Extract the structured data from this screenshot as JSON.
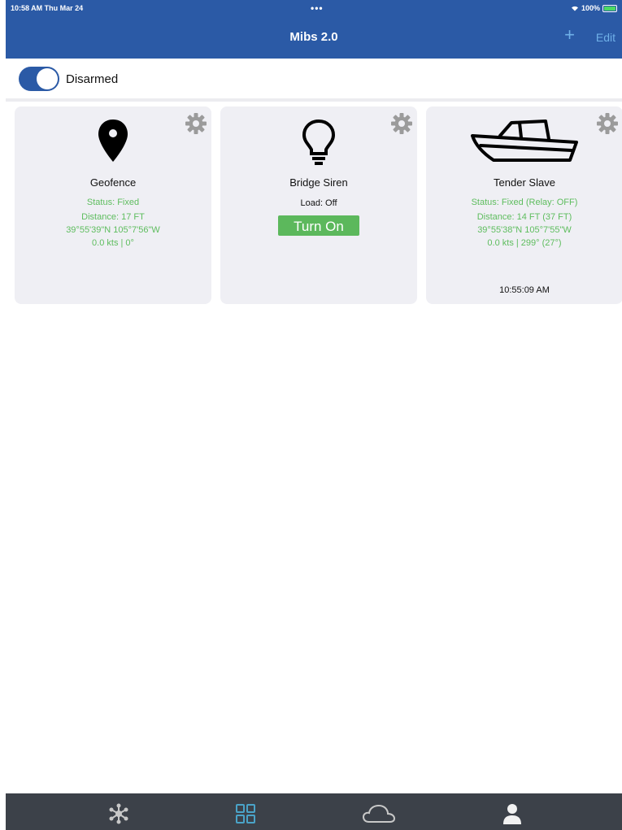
{
  "status_bar": {
    "time_date": "10:58 AM  Thu Mar 24",
    "dots": "•••",
    "battery": "100%"
  },
  "nav": {
    "title": "Mibs 2.0",
    "add_label": "+",
    "edit_label": "Edit"
  },
  "arm": {
    "label": "Disarmed",
    "toggle_on": true
  },
  "cards": [
    {
      "title": "Geofence",
      "icon": "map-pin-icon",
      "lines": [
        "Status: Fixed",
        "Distance: 17 FT",
        "39°55'39\"N 105°7'56\"W",
        "0.0 kts | 0°"
      ]
    },
    {
      "title": "Bridge Siren",
      "icon": "lightbulb-icon",
      "load": "Load: Off",
      "button_label": "Turn On"
    },
    {
      "title": "Tender Slave",
      "icon": "boat-icon",
      "lines": [
        "Status: Fixed (Relay: OFF)",
        "Distance: 14 FT (37 FT)",
        "39°55'38\"N 105°7'55\"W",
        "0.0 kts | 299° (27°)"
      ],
      "time": "10:55:09 AM"
    }
  ],
  "tabbar": {
    "tabs": [
      "network-icon",
      "grid-icon",
      "cloud-icon",
      "person-icon"
    ],
    "active_index": 1
  },
  "colors": {
    "brand_blue": "#2b5aa6",
    "link_blue": "#6fb0e8",
    "status_green": "#5ebd5e",
    "button_green": "#5cb85c",
    "card_bg": "#efeff4",
    "tabbar_bg": "#3c4149"
  }
}
